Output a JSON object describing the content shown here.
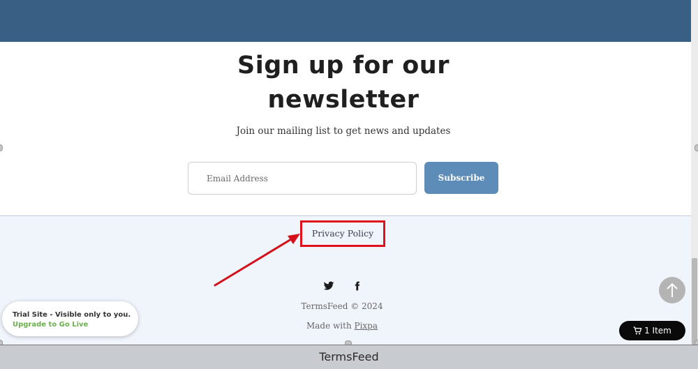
{
  "newsletter": {
    "title_line1": "Sign up for our",
    "title_line2": "newsletter",
    "subtitle": "Join our mailing list to get news and updates",
    "email_placeholder": "Email Address",
    "subscribe_label": "Subscribe"
  },
  "footer": {
    "privacy_label": "Privacy Policy",
    "copyright": "TermsFeed © 2024",
    "made_with_prefix": "Made with ",
    "made_with_link": "Pixpa",
    "social_icons": [
      "twitter-icon",
      "facebook-icon"
    ]
  },
  "cart": {
    "label": "1 Item",
    "icon": "cart-icon"
  },
  "trial_badge": {
    "text": "Trial Site - Visible only to you.",
    "link": "Upgrade to Go Live"
  },
  "caption": {
    "text": "TermsFeed"
  },
  "colors": {
    "header_band": "#3a5f85",
    "subscribe_button": "#5d8cb8",
    "footer_bg": "#f0f4fb",
    "highlight_box": "#e0101c",
    "upgrade_link": "#6ab04c"
  }
}
